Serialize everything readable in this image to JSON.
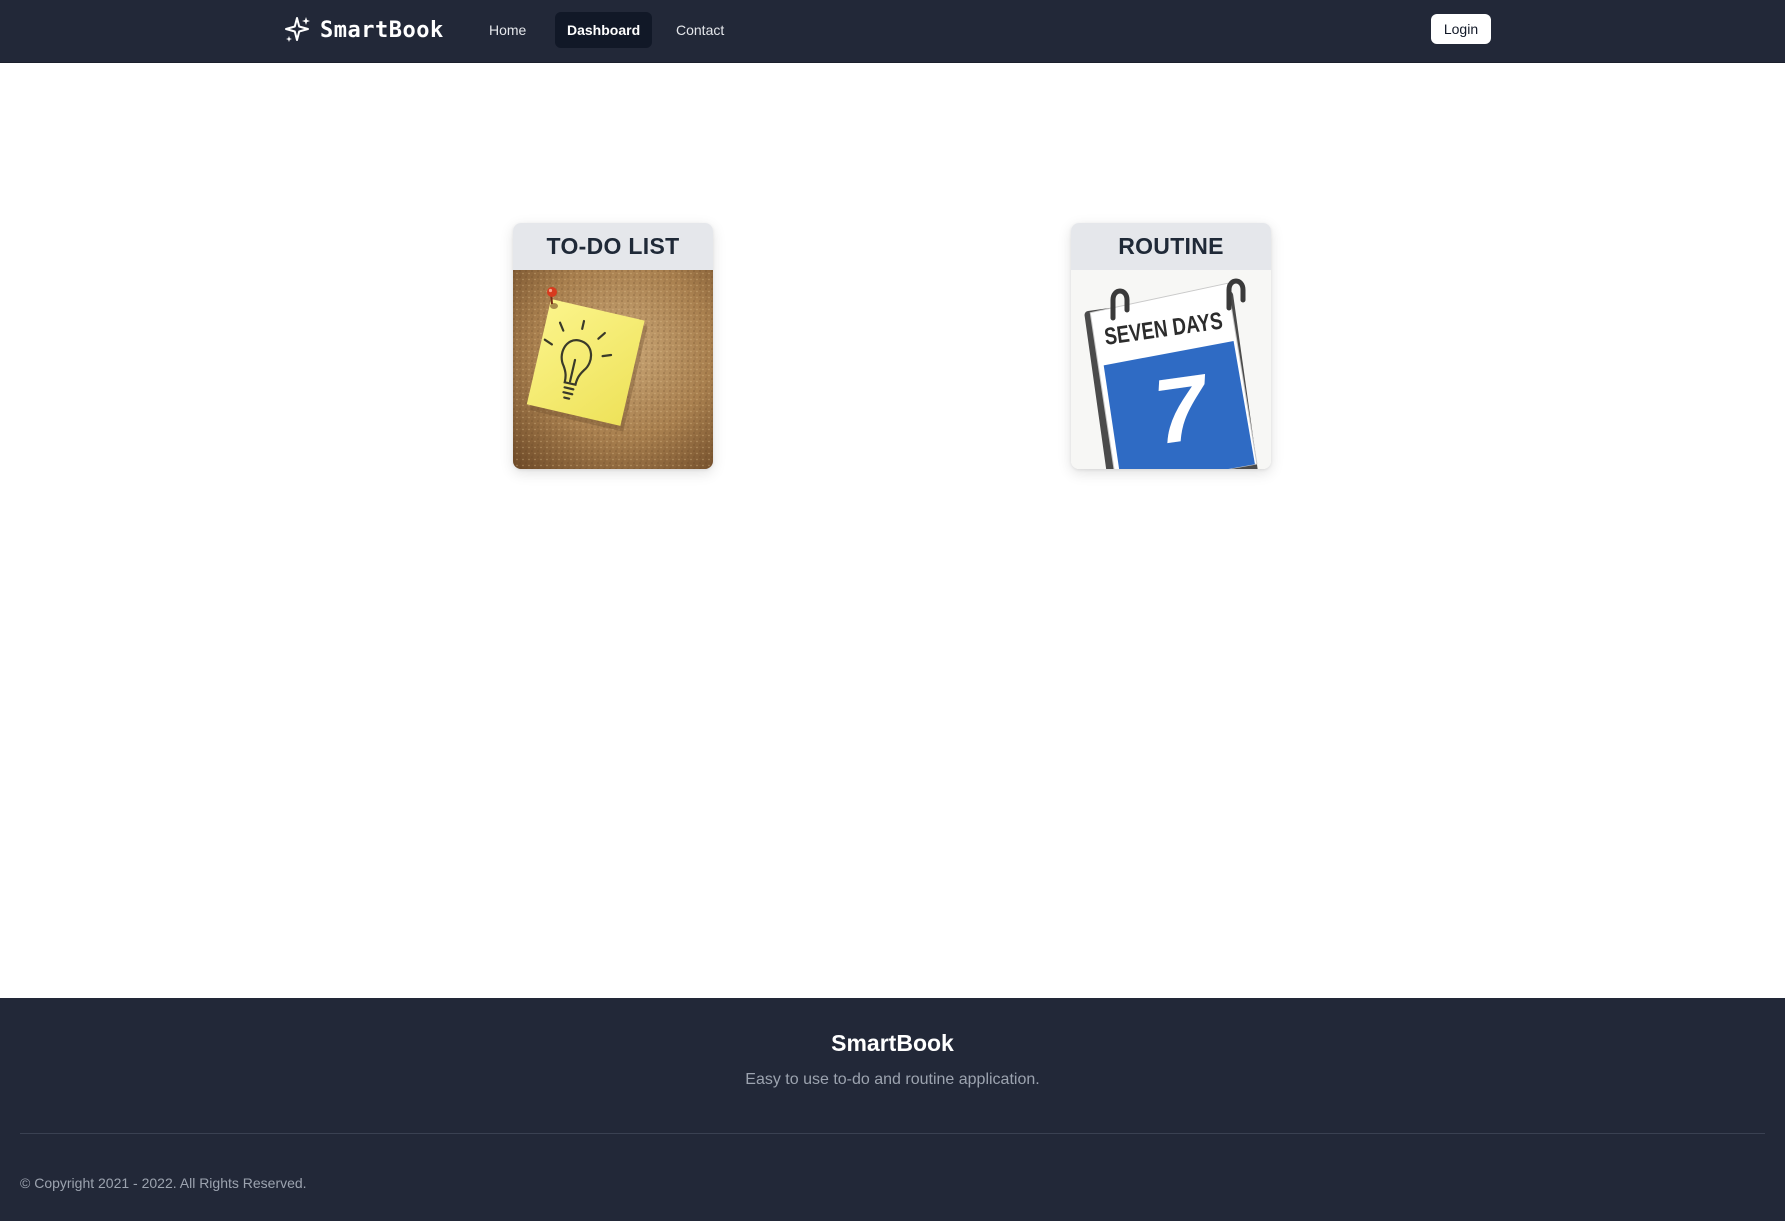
{
  "navbar": {
    "brand": {
      "name": "SmartBook",
      "icon": "sparkles-icon"
    },
    "links": [
      {
        "label": "Home",
        "active": false
      },
      {
        "label": "Dashboard",
        "active": true
      },
      {
        "label": "Contact",
        "active": false
      }
    ],
    "login_label": "Login"
  },
  "cards": [
    {
      "title": "TO-DO LIST",
      "image": "sticky-note-lightbulb-on-corkboard"
    },
    {
      "title": "ROUTINE",
      "image": "seven-days-calendar",
      "image_text": {
        "banner": "SEVEN DAYS",
        "number": "7"
      }
    }
  ],
  "footer": {
    "title": "SmartBook",
    "tagline": "Easy to use to-do and routine application.",
    "copyright": "© Copyright 2021 - 2022. All Rights Reserved."
  },
  "colors": {
    "nav_background": "#222838",
    "active_nav_background": "#111827",
    "card_header_background": "#e5e7eb",
    "calendar_blue": "#2f6bc4",
    "sticky_note_yellow": "#f5ec6e",
    "cork_brown": "#b38d5c"
  }
}
